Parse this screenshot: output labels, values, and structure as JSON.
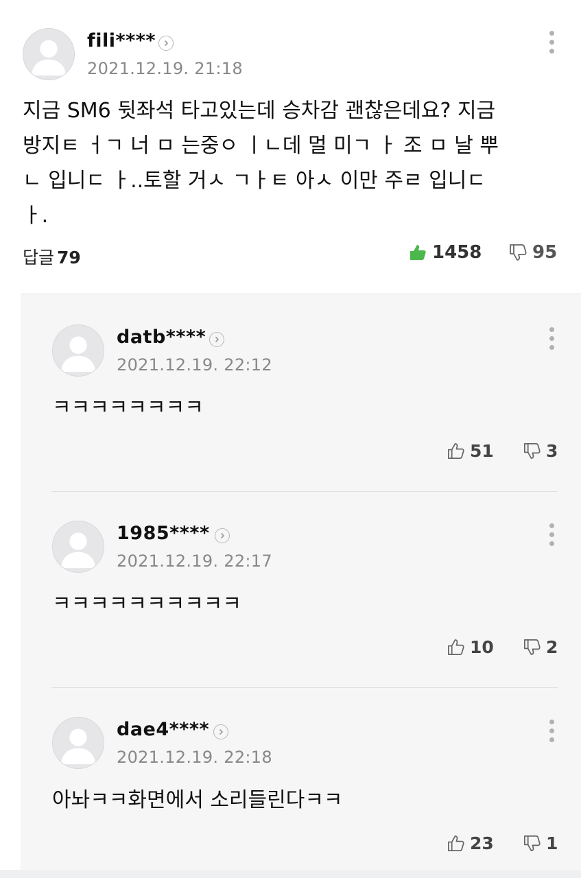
{
  "comment": {
    "username": "fili****",
    "timestamp": "2021.12.19. 21:18",
    "text": "지금 SM6 뒷좌석 타고있는데 승차감 괜찮은데요? 지금 방지ㅌ ㅓㄱ 너 ㅁ 는중ㅇ ㅣㄴ데 멀 미ㄱ ㅏ 조 ㅁ 날 뿌 ㄴ 입니ㄷ ㅏ..토할 거ㅅ ㄱㅏㅌ 아ㅅ 이만 주ㄹ 입니ㄷ ㅏ.",
    "lines": [
      "지금 SM6 뒷좌석 타고있는데 승차감 괜찮은데요? 지금",
      "방지ㅌ ㅓㄱ 너 ㅁ 는중ㅇ ㅣㄴ데 멀 미ㄱ ㅏ 조 ㅁ 날 뿌",
      "ㄴ 입니ㄷ ㅏ..토할 거ㅅ ㄱㅏㅌ 아ㅅ 이만 주ㄹ 입니ㄷ",
      "ㅏ."
    ],
    "reply_label": "답글",
    "reply_count": "79",
    "likes": "1458",
    "dislikes": "95",
    "like_color": "#4cb84c"
  },
  "replies": [
    {
      "username": "datb****",
      "timestamp": "2021.12.19. 22:12",
      "text": "ㅋㅋㅋㅋㅋㅋㅋㅋ",
      "likes": "51",
      "dislikes": "3"
    },
    {
      "username": "1985****",
      "timestamp": "2021.12.19. 22:17",
      "text": "ㅋㅋㅋㅋㅋㅋㅋㅋㅋㅋ",
      "likes": "10",
      "dislikes": "2"
    },
    {
      "username": "dae4****",
      "timestamp": "2021.12.19. 22:18",
      "text": "아놔ㅋㅋ화면에서 소리들린다ㅋㅋ",
      "likes": "23",
      "dislikes": "1"
    }
  ],
  "icons": {
    "avatar": "default-profile-icon",
    "profile_link": "chevron-right-icon",
    "more": "more-vertical-icon",
    "like": "thumbs-up-icon",
    "dislike": "thumbs-down-icon"
  }
}
